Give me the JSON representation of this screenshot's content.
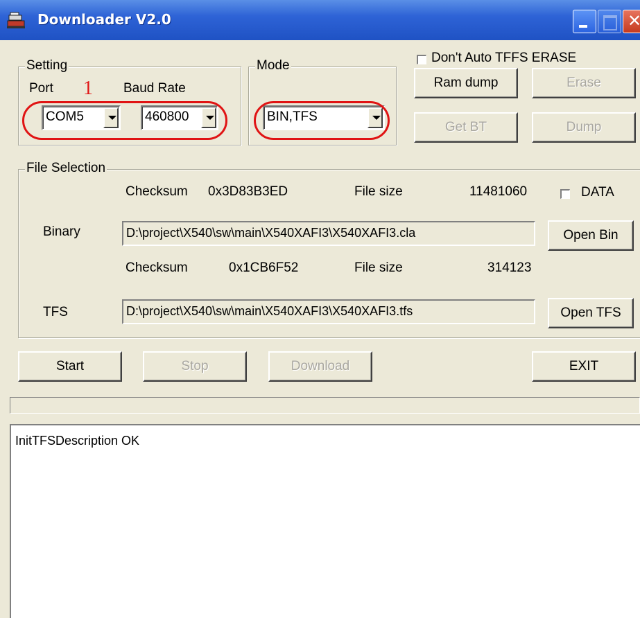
{
  "window": {
    "title": "Downloader V2.0"
  },
  "setting": {
    "group_label": "Setting",
    "port_label": "Port",
    "baud_label": "Baud Rate",
    "annotation_number": "1",
    "port_value": "COM5",
    "baud_value": "460800"
  },
  "mode": {
    "group_label": "Mode",
    "value": "BIN,TFS"
  },
  "top_right": {
    "no_auto_erase_label": "Don't Auto TFFS ERASE",
    "ram_dump": "Ram dump",
    "erase": "Erase",
    "get_bt": "Get BT",
    "dump": "Dump"
  },
  "file_selection": {
    "group_label": "File Selection",
    "binary": {
      "checksum_label": "Checksum",
      "checksum_value": "0x3D83B3ED",
      "filesize_label": "File size",
      "filesize_value": "11481060",
      "data_label": "DATA",
      "label": "Binary",
      "path": "D:\\project\\X540\\sw\\main\\X540XAFI3\\X540XAFI3.cla",
      "open_button": "Open Bin"
    },
    "tfs": {
      "checksum_label": "Checksum",
      "checksum_value": "0x1CB6F52",
      "filesize_label": "File size",
      "filesize_value": "314123",
      "label": "TFS",
      "path": "D:\\project\\X540\\sw\\main\\X540XAFI3\\X540XAFI3.tfs",
      "open_button": "Open TFS"
    }
  },
  "actions": {
    "start": "Start",
    "stop": "Stop",
    "download": "Download",
    "exit": "EXIT"
  },
  "log": {
    "text": "InitTFSDescription OK"
  },
  "colors": {
    "titlebar": "#2e63d6",
    "annotation": "#e01414",
    "face": "#ece9d8"
  }
}
